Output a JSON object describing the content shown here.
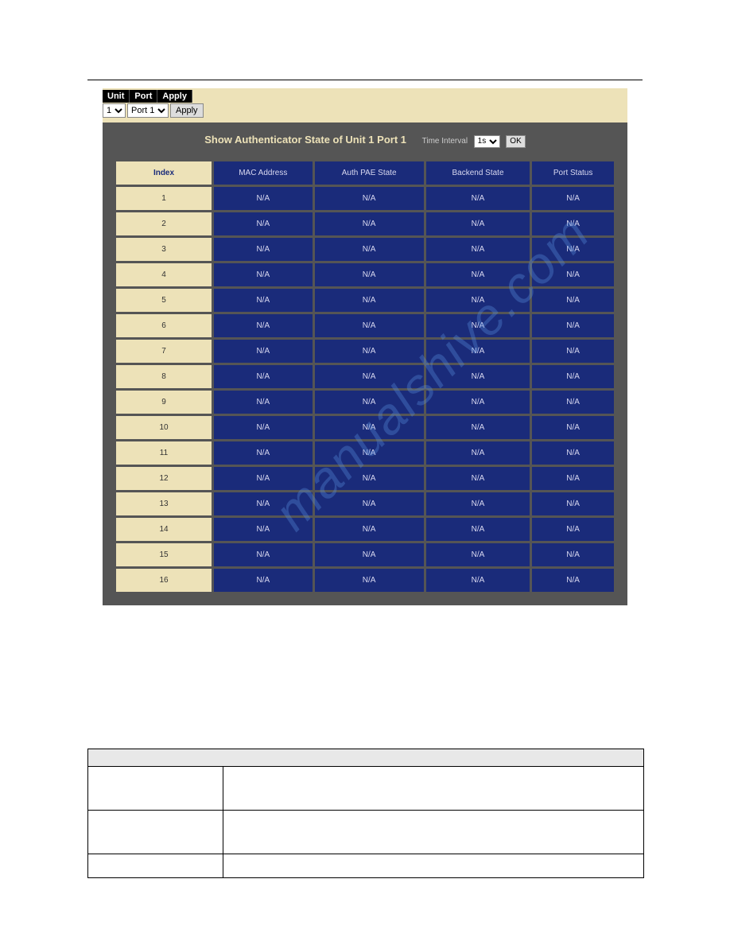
{
  "controls": {
    "unit_label": "Unit",
    "port_label": "Port",
    "apply_label": "Apply",
    "unit_value": "1",
    "port_value": "Port 1",
    "apply_btn": "Apply"
  },
  "title": {
    "main": "Show Authenticator State of Unit 1 Port 1",
    "interval_label": "Time Interval",
    "interval_value": "1s",
    "ok": "OK"
  },
  "columns": {
    "index": "Index",
    "mac": "MAC Address",
    "pae": "Auth PAE State",
    "backend": "Backend State",
    "status": "Port Status"
  },
  "rows": [
    {
      "idx": "1",
      "mac": "N/A",
      "pae": "N/A",
      "backend": "N/A",
      "status": "N/A"
    },
    {
      "idx": "2",
      "mac": "N/A",
      "pae": "N/A",
      "backend": "N/A",
      "status": "N/A"
    },
    {
      "idx": "3",
      "mac": "N/A",
      "pae": "N/A",
      "backend": "N/A",
      "status": "N/A"
    },
    {
      "idx": "4",
      "mac": "N/A",
      "pae": "N/A",
      "backend": "N/A",
      "status": "N/A"
    },
    {
      "idx": "5",
      "mac": "N/A",
      "pae": "N/A",
      "backend": "N/A",
      "status": "N/A"
    },
    {
      "idx": "6",
      "mac": "N/A",
      "pae": "N/A",
      "backend": "N/A",
      "status": "N/A"
    },
    {
      "idx": "7",
      "mac": "N/A",
      "pae": "N/A",
      "backend": "N/A",
      "status": "N/A"
    },
    {
      "idx": "8",
      "mac": "N/A",
      "pae": "N/A",
      "backend": "N/A",
      "status": "N/A"
    },
    {
      "idx": "9",
      "mac": "N/A",
      "pae": "N/A",
      "backend": "N/A",
      "status": "N/A"
    },
    {
      "idx": "10",
      "mac": "N/A",
      "pae": "N/A",
      "backend": "N/A",
      "status": "N/A"
    },
    {
      "idx": "11",
      "mac": "N/A",
      "pae": "N/A",
      "backend": "N/A",
      "status": "N/A"
    },
    {
      "idx": "12",
      "mac": "N/A",
      "pae": "N/A",
      "backend": "N/A",
      "status": "N/A"
    },
    {
      "idx": "13",
      "mac": "N/A",
      "pae": "N/A",
      "backend": "N/A",
      "status": "N/A"
    },
    {
      "idx": "14",
      "mac": "N/A",
      "pae": "N/A",
      "backend": "N/A",
      "status": "N/A"
    },
    {
      "idx": "15",
      "mac": "N/A",
      "pae": "N/A",
      "backend": "N/A",
      "status": "N/A"
    },
    {
      "idx": "16",
      "mac": "N/A",
      "pae": "N/A",
      "backend": "N/A",
      "status": "N/A"
    }
  ],
  "watermark": "manualshive.com"
}
